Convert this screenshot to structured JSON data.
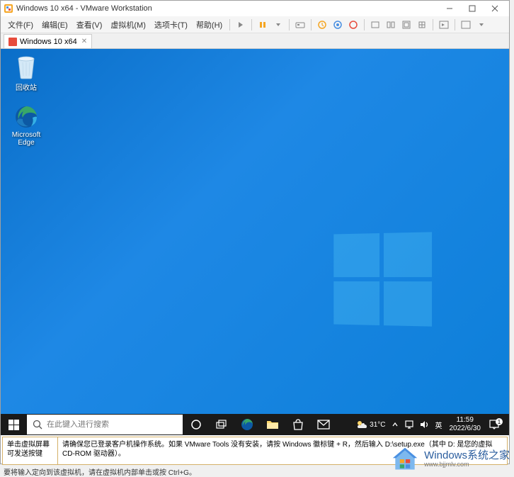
{
  "titlebar": {
    "title": "Windows 10 x64 - VMware Workstation"
  },
  "menu": {
    "file": "文件(F)",
    "edit": "编辑(E)",
    "view": "查看(V)",
    "vm": "虚拟机(M)",
    "tabs": "选项卡(T)",
    "help": "帮助(H)"
  },
  "tab": {
    "label": "Windows 10 x64"
  },
  "desktop": {
    "recycle_bin": "回收站",
    "edge": "Microsoft Edge"
  },
  "taskbar": {
    "search_placeholder": "在此键入进行搜索",
    "weather_temp": "31°C",
    "ime": "英",
    "time": "11:59",
    "date": "2022/6/30",
    "notif_count": "1"
  },
  "hints": {
    "left": "单击虚拟屏幕可发送按键",
    "right": "请确保您已登录客户机操作系统。如果 VMware Tools 没有安装，请按 Windows 徽标键 + R，然后输入 D:\\setup.exe（其中 D: 是您的虚拟 CD-ROM 驱动器）。"
  },
  "statusbar": {
    "text": "要将输入定向到该虚拟机，请在虚拟机内部单击或按 Ctrl+G。"
  },
  "watermark": {
    "main": "Windows系统之家",
    "sub": "www.bjjmlv.com"
  }
}
